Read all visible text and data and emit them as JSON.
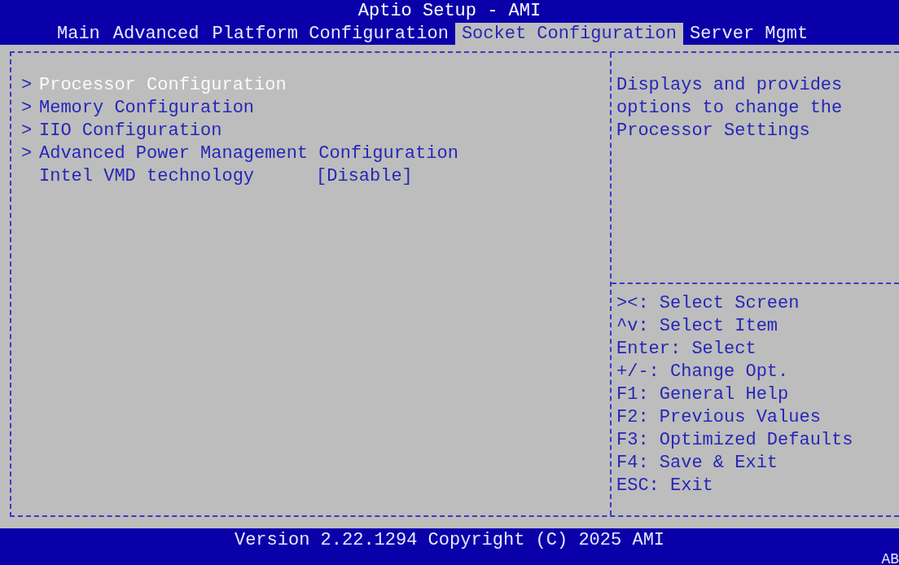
{
  "window": {
    "title": "Aptio Setup - AMI"
  },
  "tabs": [
    {
      "label": "Main",
      "selected": false
    },
    {
      "label": "Advanced",
      "selected": false
    },
    {
      "label": "Platform Configuration",
      "selected": false
    },
    {
      "label": "Socket Configuration",
      "selected": true
    },
    {
      "label": "Server Mgmt",
      "selected": false
    }
  ],
  "menu": [
    {
      "kind": "submenu",
      "arrow": ">",
      "label": "Processor Configuration",
      "selected": true
    },
    {
      "kind": "submenu",
      "arrow": ">",
      "label": "Memory Configuration",
      "selected": false
    },
    {
      "kind": "submenu",
      "arrow": ">",
      "label": "IIO Configuration",
      "selected": false
    },
    {
      "kind": "submenu",
      "arrow": ">",
      "label": "Advanced Power Management Configuration",
      "selected": false
    },
    {
      "kind": "setting",
      "label": "Intel VMD technology",
      "value": "[Disable]",
      "selected": false
    }
  ],
  "help": {
    "description": "Displays and provides options to change the Processor Settings",
    "keys": [
      "><: Select Screen",
      "^v: Select Item",
      "Enter: Select",
      "+/-: Change Opt.",
      "F1: General Help",
      "F2: Previous Values",
      "F3: Optimized Defaults",
      "F4: Save & Exit",
      "ESC: Exit"
    ]
  },
  "footer": {
    "copyright": "Version 2.22.1294 Copyright (C) 2025 AMI",
    "indicator": "AB"
  }
}
